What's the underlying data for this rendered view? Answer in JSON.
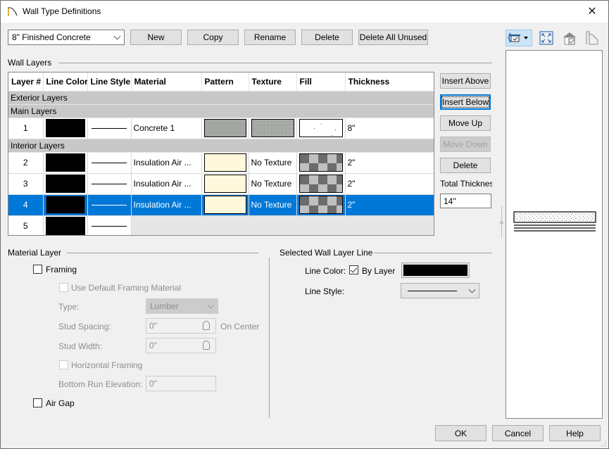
{
  "window": {
    "title": "Wall Type Definitions",
    "close_label": "✕"
  },
  "toolbar": {
    "wall_type_selected": "8\" Finished Concrete",
    "new_label": "New",
    "copy_label": "Copy",
    "rename_label": "Rename",
    "delete_label": "Delete",
    "delete_all_unused_label": "Delete All Unused"
  },
  "preview_toolbar": {
    "icons": [
      "view-options-icon",
      "fill-window-icon",
      "house-check-icon",
      "wall-layers-icon"
    ]
  },
  "wall_layers": {
    "group_label": "Wall Layers",
    "columns": [
      "Layer #",
      "Line Color",
      "Line Style",
      "Material",
      "Pattern",
      "Texture",
      "Fill",
      "Thickness"
    ],
    "sections": {
      "exterior": "Exterior Layers",
      "main": "Main Layers",
      "interior": "Interior Layers"
    },
    "rows": [
      {
        "layer": "1",
        "line_color": "#000000",
        "line_style": "solid",
        "material": "Concrete 1",
        "pattern": "concrete-gray",
        "texture": "",
        "texture_swatch": "concrete",
        "fill": "concrete-stipple",
        "thickness": "8\""
      },
      {
        "layer": "2",
        "line_color": "#000000",
        "line_style": "solid",
        "material": "Insulation  Air ...",
        "pattern": "cream",
        "texture": "No Texture",
        "fill": "checker",
        "thickness": "2\""
      },
      {
        "layer": "3",
        "line_color": "#000000",
        "line_style": "solid",
        "material": "Insulation  Air ...",
        "pattern": "cream",
        "texture": "No Texture",
        "fill": "checker",
        "thickness": "2\""
      },
      {
        "layer": "4",
        "line_color": "#000000",
        "line_style": "solid",
        "material": "Insulation  Air ...",
        "pattern": "cream",
        "texture": "No Texture",
        "fill": "checker",
        "thickness": "2\"",
        "selected": true
      },
      {
        "layer": "5",
        "line_color": "#000000",
        "line_style": "solid"
      }
    ]
  },
  "side_buttons": {
    "insert_above": "Insert Above",
    "insert_below": "Insert Below",
    "move_up": "Move Up",
    "move_down": "Move Down",
    "delete": "Delete",
    "total_thickness_label": "Total Thicknes",
    "total_thickness_value": "14\""
  },
  "material_layer": {
    "group_label": "Material Layer",
    "framing_label": "Framing",
    "framing_checked": false,
    "use_default_framing_label": "Use Default Framing Material",
    "type_label": "Type:",
    "type_value": "Lumber",
    "stud_spacing_label": "Stud Spacing:",
    "stud_spacing_value": "0\"",
    "on_center_label": "On Center",
    "stud_width_label": "Stud Width:",
    "stud_width_value": "0\"",
    "horizontal_framing_label": "Horizontal Framing",
    "bottom_run_label": "Bottom Run Elevation:",
    "bottom_run_value": "0\"",
    "air_gap_label": "Air Gap",
    "air_gap_checked": false
  },
  "selected_line": {
    "group_label": "Selected Wall Layer Line",
    "line_color_label": "Line Color:",
    "by_layer_label": "By Layer",
    "by_layer_checked": true,
    "line_color_value": "#000000",
    "line_style_label": "Line Style:"
  },
  "footer": {
    "ok_label": "OK",
    "cancel_label": "Cancel",
    "help_label": "Help"
  },
  "colors": {
    "selection": "#0078d7",
    "section_bg": "#c8c8c8"
  }
}
